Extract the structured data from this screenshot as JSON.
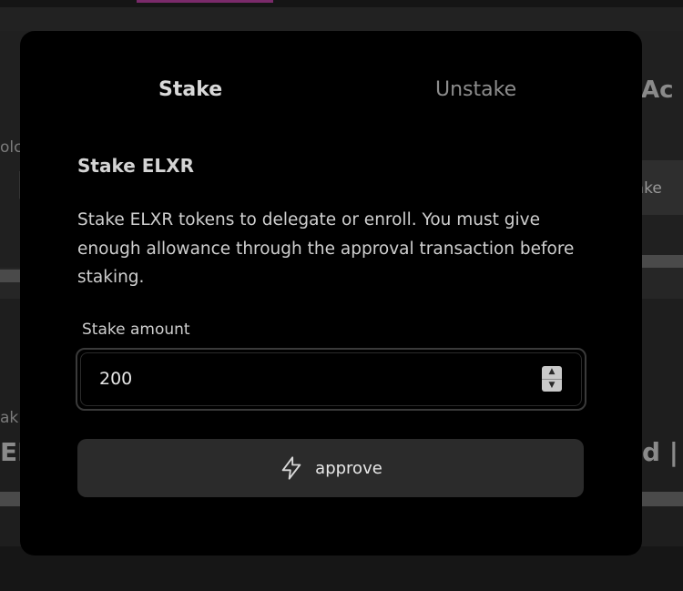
{
  "background": {
    "fragment_a": "Ac",
    "fragment_b": "olc",
    "fragment_c": "take",
    "fragment_d": "ak",
    "fragment_e": "EL",
    "fragment_f": "ed |"
  },
  "modal": {
    "tabs": [
      {
        "label": "Stake",
        "active": true
      },
      {
        "label": "Unstake",
        "active": false
      }
    ],
    "title": "Stake ELXR",
    "description": "Stake ELXR tokens to delegate or enroll. You must give enough allowance through the approval transaction before staking.",
    "amount_field": {
      "label": "Stake amount",
      "value": "200",
      "stepper_up": "▲",
      "stepper_down": "▼"
    },
    "approve_button": {
      "label": "approve",
      "icon": "lightning-bolt-icon"
    }
  },
  "colors": {
    "modal_background": "#000000",
    "button_background": "#2b2b2b",
    "active_tab": "#d9d9d9",
    "inactive_tab": "#8d8d8d"
  }
}
